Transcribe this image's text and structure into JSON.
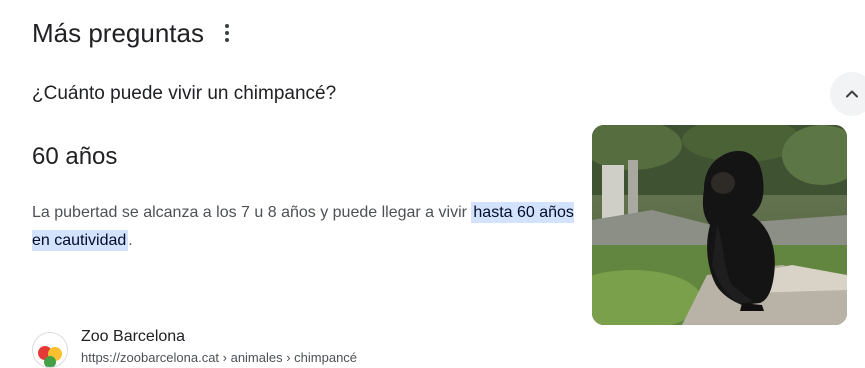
{
  "header": {
    "title": "Más preguntas",
    "more_icon": "more-vert-icon"
  },
  "question": {
    "text": "¿Cuánto puede vivir un chimpancé?",
    "toggle_icon": "chevron-up-icon",
    "expanded": true
  },
  "answer": {
    "title": "60 años",
    "text_before": "La pubertad se alcanza a los 7 u 8 años y puede llegar a vivir ",
    "highlight": "hasta 60 años en cautividad",
    "text_after": ".",
    "highlight_color": "#d3e3fd"
  },
  "image": {
    "subject": "chimpanzee-photo"
  },
  "source": {
    "name": "Zoo Barcelona",
    "url": "https://zoobarcelona.cat › animales › chimpancé",
    "logo_icon": "zoo-barcelona-logo"
  }
}
